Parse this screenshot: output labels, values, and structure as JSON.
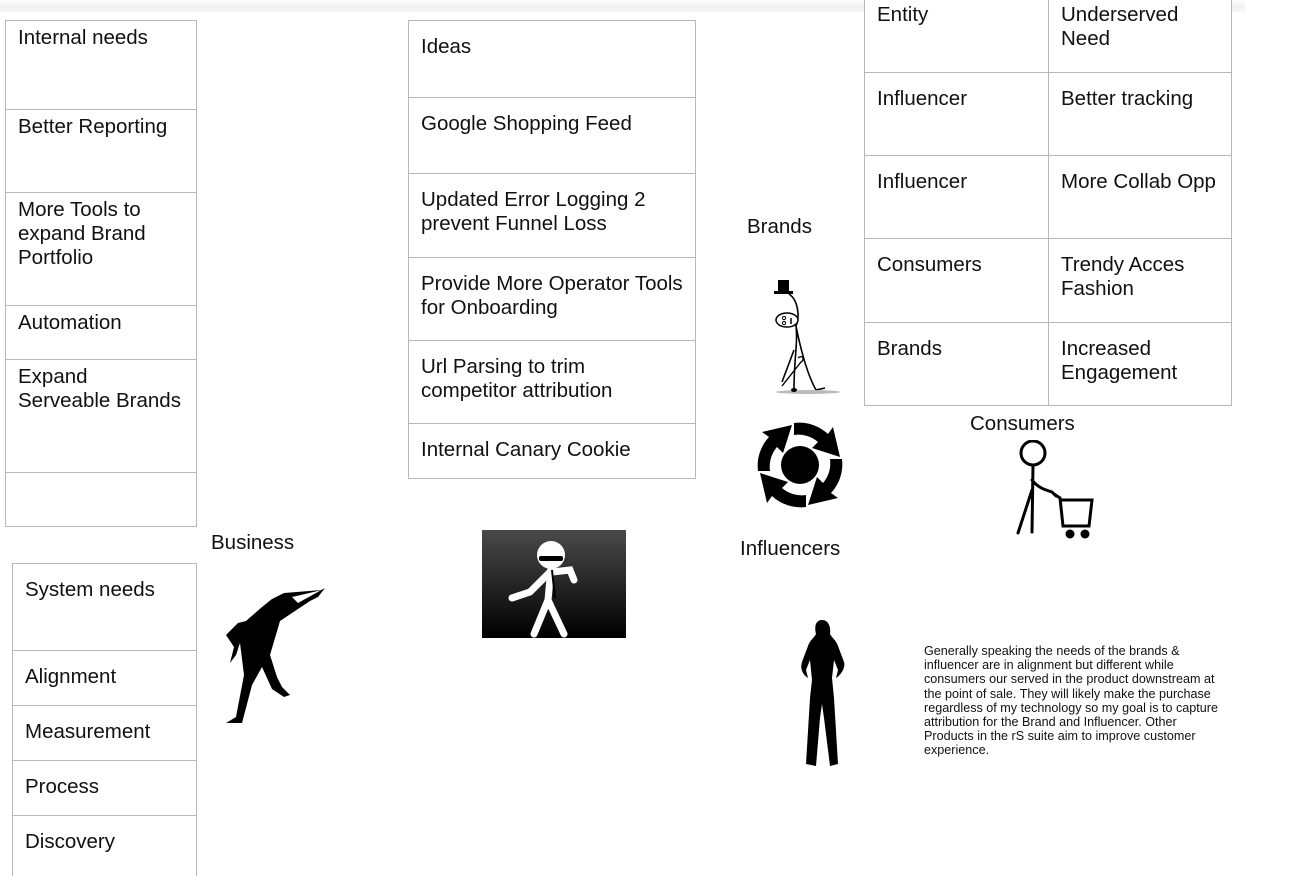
{
  "internal_needs": {
    "rows": [
      "Internal needs",
      "Better Reporting",
      "More Tools to expand Brand Portfolio",
      "Automation",
      "Expand Serveable Brands",
      ""
    ]
  },
  "system_needs": {
    "rows": [
      "System needs",
      "Alignment",
      "Measurement",
      "Process",
      "Discovery"
    ]
  },
  "ideas": {
    "rows": [
      "Ideas",
      "Google Shopping Feed",
      "Updated Error Logging 2 prevent Funnel Loss",
      "Provide More Operator Tools for Onboarding",
      "Url Parsing to trim competitor attribution",
      "Internal Canary Cookie"
    ]
  },
  "entity_table": {
    "headers": [
      "Entity",
      "Underserved Need"
    ],
    "rows": [
      [
        "Influencer",
        "Better tracking"
      ],
      [
        "Influencer",
        "More Collab Opp"
      ],
      [
        "Consumers",
        "Trendy Acces Fashion"
      ],
      [
        "Brands",
        "Increased Engagement"
      ]
    ]
  },
  "labels": {
    "business": "Business",
    "brands": "Brands",
    "influencers": "Influencers",
    "consumers": "Consumers"
  },
  "icons": {
    "business": "pointing-man-silhouette-icon",
    "developer": "stick-figure-sunglasses-icon",
    "brands": "top-hat-stick-figure-icon",
    "influencers": "cycle-arrows-icon",
    "consumers": "shopping-cart-person-icon",
    "woman": "woman-silhouette-icon"
  },
  "note": "Generally speaking the needs of the brands & influencer are in alignment but different while consumers our served in the product downstream at the point of sale. They will likely make the purchase regardless of my technology so my goal is to capture attribution for the Brand and Influencer. Other Products in the rS suite aim to improve customer experience."
}
